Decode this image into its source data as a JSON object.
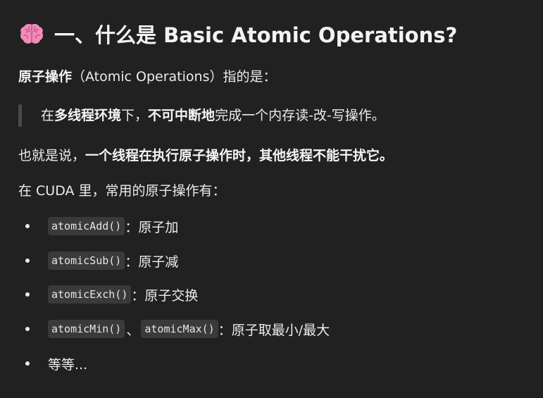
{
  "heading": {
    "icon": "brain-icon",
    "title": "一、什么是 Basic Atomic Operations?"
  },
  "intro": {
    "bold": "原子操作",
    "rest": "（Atomic Operations）指的是："
  },
  "quote": {
    "t1": "在",
    "b1": "多线程环境",
    "t2": "下，",
    "b2": "不可中断地",
    "t3": "完成一个内存读-改-写操作。"
  },
  "para1": {
    "t1": "也就是说，",
    "b1": "一个线程在执行原子操作时，其他线程不能干扰它。"
  },
  "para2": {
    "text": "在 CUDA 里，常用的原子操作有："
  },
  "list": [
    {
      "code": "atomicAdd()",
      "desc": "：原子加"
    },
    {
      "code": "atomicSub()",
      "desc": "：原子减"
    },
    {
      "code": "atomicExch()",
      "desc": "：原子交换"
    },
    {
      "code": "atomicMin()",
      "sep": "、",
      "code2": "atomicMax()",
      "desc": "：原子取最小/最大"
    },
    {
      "text": "等等..."
    }
  ],
  "colors": {
    "background": "#212121",
    "text": "#ececec",
    "code_bg": "#3a3a3a",
    "brain": "#f28bb8"
  }
}
